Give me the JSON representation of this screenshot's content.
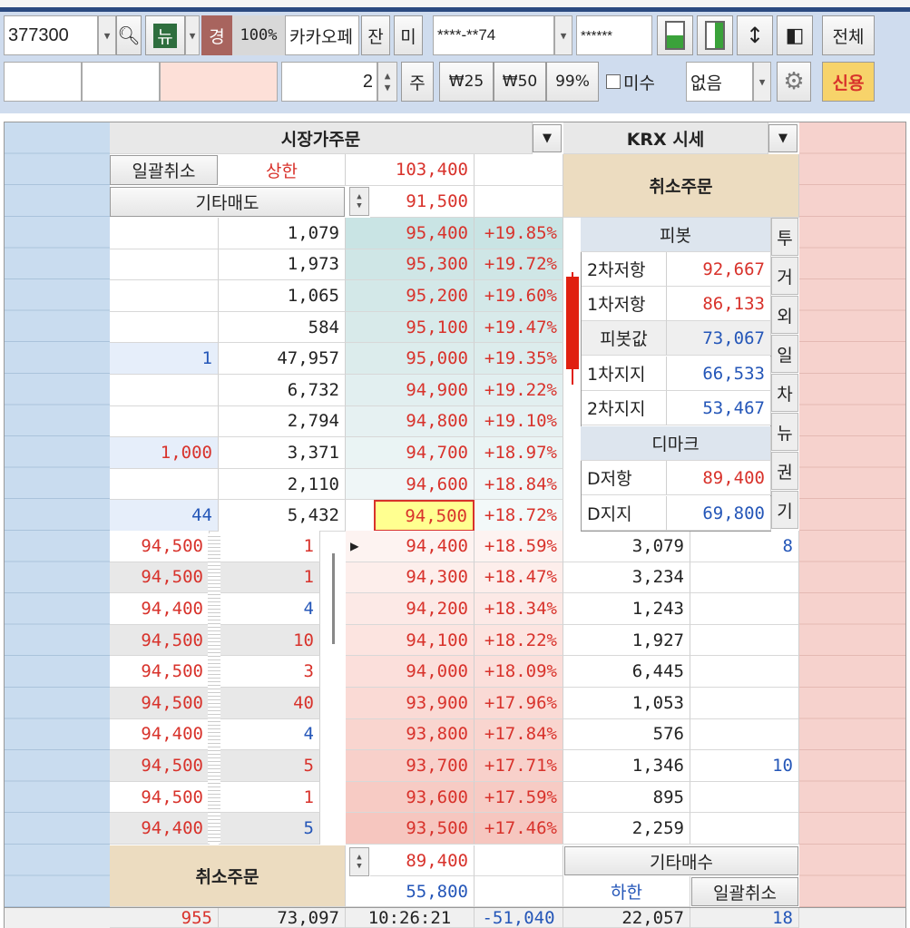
{
  "toolbar": {
    "code": "377300",
    "news": "뉴",
    "warn": "경",
    "ratio": "100%",
    "name": "카카오페",
    "jan": "잔",
    "mi": "미",
    "account": "****-**74",
    "password": "******",
    "all": "전체",
    "qty": "2",
    "ju": "주",
    "w25": "₩25",
    "w50": "₩50",
    "p99": "99%",
    "misu": "미수",
    "cond": "없음",
    "credit": "신용"
  },
  "header": {
    "market_order": "시장가주문",
    "krx": "KRX 시세",
    "bulk_cancel": "일괄취소",
    "upper": "상한",
    "upper_price": "103,400",
    "cancel_order": "취소주문",
    "other_sell": "기타매도",
    "sell_price": "91,500"
  },
  "asks": [
    {
      "q": "",
      "v": "1,079",
      "p": "95,400",
      "pct": "+19.85%"
    },
    {
      "q": "",
      "v": "1,973",
      "p": "95,300",
      "pct": "+19.72%"
    },
    {
      "q": "",
      "v": "1,065",
      "p": "95,200",
      "pct": "+19.60%"
    },
    {
      "q": "",
      "v": "584",
      "p": "95,100",
      "pct": "+19.47%"
    },
    {
      "q": "1",
      "v": "47,957",
      "p": "95,000",
      "pct": "+19.35%"
    },
    {
      "q": "",
      "v": "6,732",
      "p": "94,900",
      "pct": "+19.22%"
    },
    {
      "q": "",
      "v": "2,794",
      "p": "94,800",
      "pct": "+19.10%"
    },
    {
      "q": "1,000",
      "v": "3,371",
      "p": "94,700",
      "pct": "+18.97%"
    },
    {
      "q": "",
      "v": "2,110",
      "p": "94,600",
      "pct": "+18.84%"
    },
    {
      "q": "44",
      "v": "5,432",
      "p": "94,500",
      "pct": "+18.72%"
    }
  ],
  "trades": [
    {
      "p": "94,500",
      "q": "1",
      "c": "red"
    },
    {
      "p": "94,500",
      "q": "1",
      "c": "red"
    },
    {
      "p": "94,400",
      "q": "4",
      "c": "blue"
    },
    {
      "p": "94,500",
      "q": "10",
      "c": "red"
    },
    {
      "p": "94,500",
      "q": "3",
      "c": "red"
    },
    {
      "p": "94,500",
      "q": "40",
      "c": "red"
    },
    {
      "p": "94,400",
      "q": "4",
      "c": "blue"
    },
    {
      "p": "94,500",
      "q": "5",
      "c": "red"
    },
    {
      "p": "94,500",
      "q": "1",
      "c": "red"
    },
    {
      "p": "94,400",
      "q": "5",
      "c": "blue"
    }
  ],
  "bids": [
    {
      "p": "94,400",
      "pct": "+18.59%",
      "v": "3,079",
      "q": "8"
    },
    {
      "p": "94,300",
      "pct": "+18.47%",
      "v": "3,234",
      "q": ""
    },
    {
      "p": "94,200",
      "pct": "+18.34%",
      "v": "1,243",
      "q": ""
    },
    {
      "p": "94,100",
      "pct": "+18.22%",
      "v": "1,927",
      "q": ""
    },
    {
      "p": "94,000",
      "pct": "+18.09%",
      "v": "6,445",
      "q": ""
    },
    {
      "p": "93,900",
      "pct": "+17.96%",
      "v": "1,053",
      "q": ""
    },
    {
      "p": "93,800",
      "pct": "+17.84%",
      "v": "576",
      "q": ""
    },
    {
      "p": "93,700",
      "pct": "+17.71%",
      "v": "1,346",
      "q": "10"
    },
    {
      "p": "93,600",
      "pct": "+17.59%",
      "v": "895",
      "q": ""
    },
    {
      "p": "93,500",
      "pct": "+17.46%",
      "v": "2,259",
      "q": ""
    }
  ],
  "pivot": {
    "title": "피봇",
    "r2": "2차저항",
    "r2v": "92,667",
    "r1": "1차저항",
    "r1v": "86,133",
    "pv": "피봇값",
    "pvv": "73,067",
    "s1": "1차지지",
    "s1v": "66,533",
    "s2": "2차지지",
    "s2v": "53,467",
    "dmark": "디마크",
    "dr": "D저항",
    "drv": "89,400",
    "ds": "D지지",
    "dsv": "69,800"
  },
  "side_tabs": [
    "투",
    "거",
    "외",
    "일",
    "차",
    "뉴",
    "권",
    "기"
  ],
  "bottom": {
    "cancel_order": "취소주문",
    "buy_price": "89,400",
    "lower_price": "55,800",
    "other_buy": "기타매수",
    "lower": "하한",
    "bulk_cancel": "일괄취소"
  },
  "footer": {
    "ask_total_q": "955",
    "ask_total": "73,097",
    "time": "10:26:21",
    "diff": "-51,040",
    "bid_total": "22,057",
    "bid_total_q": "18"
  }
}
